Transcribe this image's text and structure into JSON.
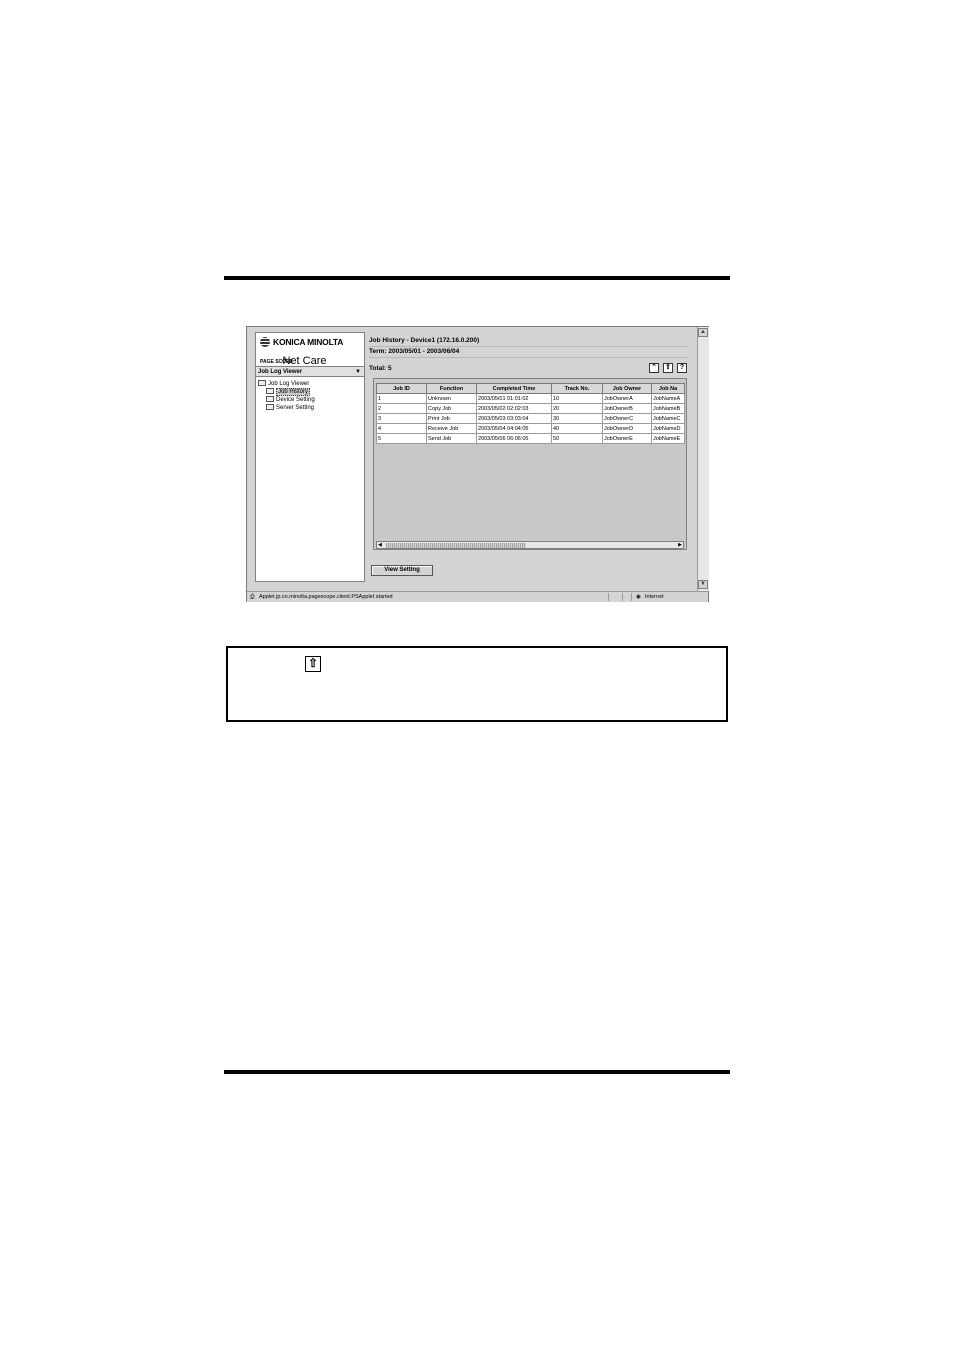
{
  "left_panel": {
    "logo_brand": "KONICA MINOLTA",
    "logo_product_small": "PAGE SCOPE",
    "logo_product": "Net Care",
    "dropdown_value": "Job Log Viewer",
    "tree": [
      "Job Log Viewer",
      "Job History",
      "Device Setting",
      "Server Setting"
    ]
  },
  "header": {
    "title": "Job History - Device1  (172.16.0.200)",
    "term": "Term: 2003/05/01 - 2003/06/04",
    "total": "Total: 5"
  },
  "toolbar_icons": [
    "collapse-up-icon",
    "export-icon",
    "help-icon"
  ],
  "table": {
    "columns": [
      "Job ID",
      "Function",
      "Completed Time",
      "Track No.",
      "Job Owner",
      "Job Na"
    ],
    "rows": [
      [
        "1",
        "Unknown",
        "2003/05/01 01:01:02",
        "10",
        "JobOwnerA",
        "JobNameA"
      ],
      [
        "2",
        "Copy Job",
        "2003/05/02 02:02:03",
        "20",
        "JobOwnerB",
        "JobNameB"
      ],
      [
        "3",
        "Print Job",
        "2003/05/03 03:03:04",
        "30",
        "JobOwnerC",
        "JobNameC"
      ],
      [
        "4",
        "Receive Job",
        "2003/05/04 04:04:05",
        "40",
        "JobOwnerD",
        "JobNameD"
      ],
      [
        "5",
        "Send Job",
        "2003/05/06 06:06:05",
        "50",
        "JobOwnerE",
        "JobNameE"
      ]
    ]
  },
  "view_setting_label": "View Setting",
  "status_bar": {
    "text": "Applet jp.co.minolta.pagescope.client.PSApplet started",
    "zone": "Internet"
  }
}
